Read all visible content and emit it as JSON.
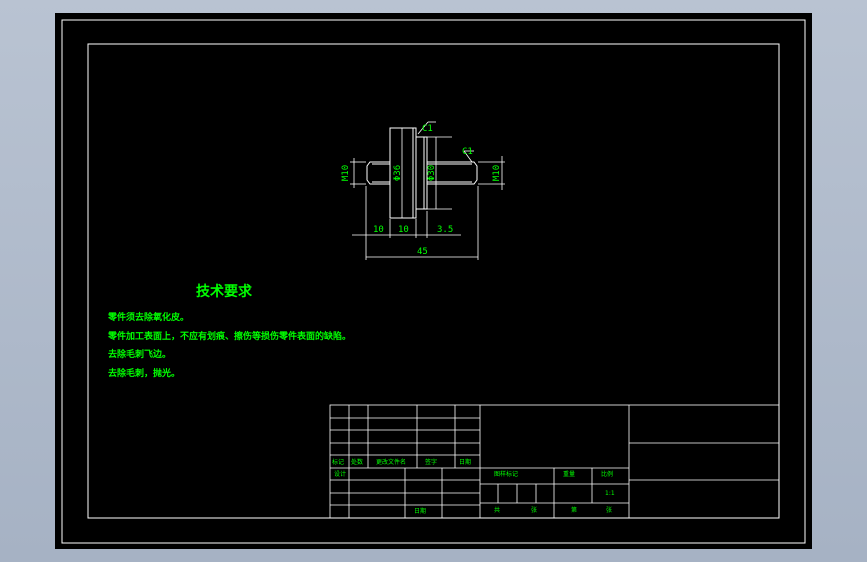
{
  "colors": {
    "sheet": "#000000",
    "frame": "#ffffff",
    "text": "#00ff00",
    "dimension": "#ffffff"
  },
  "drawing": {
    "dimensions": {
      "d_left_thread": "M10",
      "d_collar": "Φ36",
      "d_shoulder": "Φ30",
      "d_right_thread": "M10",
      "chamfer_1": "C1",
      "chamfer_2": "C1",
      "len_left": "10",
      "len_collar": "10",
      "len_shoulder": "3.5",
      "len_total": "45"
    }
  },
  "technical_requirements": {
    "title": "技术要求",
    "items": [
      "零件须去除氧化皮。",
      "零件加工表面上，不应有划痕、擦伤等损伤零件表面的缺陷。",
      "去除毛刺飞边。",
      "去除毛刺，抛光。"
    ]
  },
  "title_block": {
    "revision_headers": [
      "标记",
      "处数",
      "更改文件名",
      "签字",
      "日期"
    ],
    "design_label": "设计",
    "date_label": "日期",
    "stage_label": "图样标记",
    "weight_label": "重量",
    "scale_label": "比例",
    "scale_value": "1:1",
    "total_label": "共",
    "sheet_label": "张",
    "sheet_no_label": "第",
    "sheet_no_unit": "张"
  }
}
